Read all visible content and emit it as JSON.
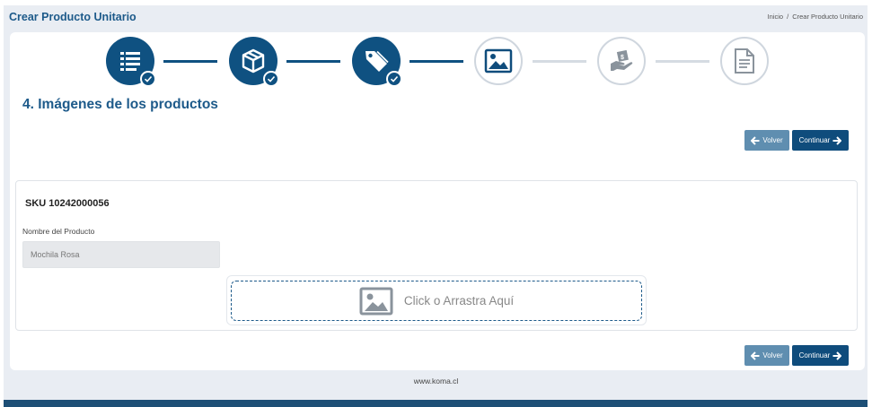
{
  "header": {
    "title": "Crear Producto Unitario",
    "breadcrumb": {
      "home": "Inicio",
      "separator": "/",
      "current": "Crear Producto Unitario"
    }
  },
  "stepper": {
    "steps": [
      {
        "icon": "list-icon",
        "status": "done"
      },
      {
        "icon": "box-icon",
        "status": "done"
      },
      {
        "icon": "tag-icon",
        "status": "done"
      },
      {
        "icon": "image-icon",
        "status": "current"
      },
      {
        "icon": "money-hand-icon",
        "status": "pending"
      },
      {
        "icon": "document-icon",
        "status": "pending"
      }
    ]
  },
  "section": {
    "heading": "4. Imágenes de los productos"
  },
  "actions": {
    "back_label": "Volver",
    "continue_label": "Continuar"
  },
  "product": {
    "sku_label": "SKU 10242000056",
    "name_label": "Nombre del Producto",
    "name_value": "Mochila Rosa"
  },
  "upload": {
    "text": "Click o Arrastra Aquí"
  },
  "footer": {
    "text": "www.koma.cl"
  },
  "colors": {
    "primary": "#0f5181",
    "secondary": "#5f8eb0",
    "background": "#e9edf3"
  }
}
